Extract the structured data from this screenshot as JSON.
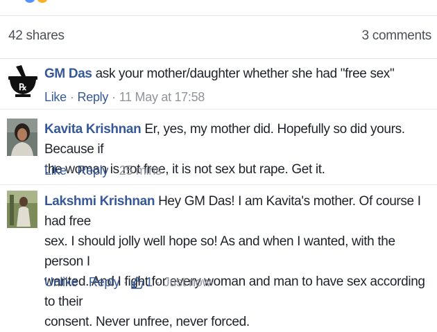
{
  "post_stats": {
    "shares": "42 shares",
    "comments": "3 comments"
  },
  "comments": [
    {
      "author": "GM Das",
      "text": "ask your mother/daughter whether she had \"free sex\"",
      "like_label": "Like",
      "reply_label": "Reply",
      "timestamp": "11 May at 17:58",
      "avatar_icon": "pharmacy-rx-icon"
    },
    {
      "author": "Kavita Krishnan",
      "text_lines": [
        "Er, yes, my mother did. Hopefully so did yours. Because if",
        "the woman is not free, it is not sex but rape. Get it."
      ],
      "like_label": "Like",
      "reply_label": "Reply",
      "timestamp": "25 mins",
      "avatar_icon": "user-photo"
    },
    {
      "author": "Lakshmi Krishnan",
      "text_lines": [
        "Hey GM Das! I am Kavita's mother. Of course I had free",
        "sex. I should jolly well hope so! As and when I wanted, with the person I",
        "wanted. And I fight for every woman and man to have sex according to their",
        "consent. Never unfree, never forced."
      ],
      "like_label": "Unlike",
      "reply_label": "Reply",
      "like_count": "1",
      "timestamp": "Just now",
      "avatar_icon": "user-photo"
    }
  ],
  "colors": {
    "link_blue": "#365899",
    "meta_gray": "#90949c",
    "text": "#1d2129"
  }
}
